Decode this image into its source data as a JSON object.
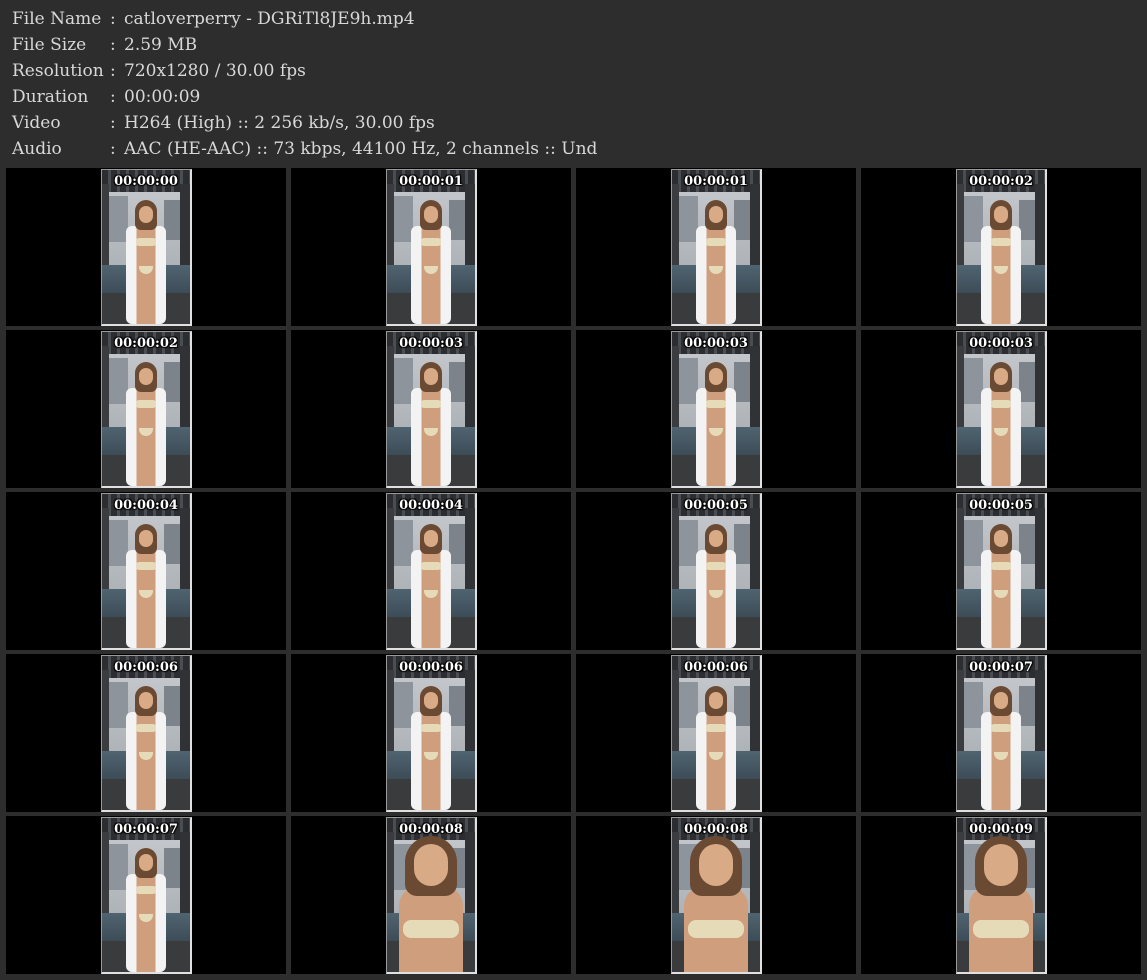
{
  "info": [
    {
      "label": "File Name",
      "sep": ":",
      "value": "catloverperry - DGRiTl8JE9h.mp4"
    },
    {
      "label": "File Size",
      "sep": ":",
      "value": "2.59 MB"
    },
    {
      "label": "Resolution",
      "sep": ":",
      "value": "720x1280 / 30.00 fps"
    },
    {
      "label": "Duration",
      "sep": ":",
      "value": "00:00:09"
    },
    {
      "label": "Video",
      "sep": ":",
      "value": "H264 (High) :: 2 256 kb/s, 30.00 fps"
    },
    {
      "label": "Audio",
      "sep": ":",
      "value": "AAC (HE-AAC) :: 73 kbps, 44100 Hz, 2 channels :: Und"
    }
  ],
  "thumbnails": [
    {
      "time": "00:00:00"
    },
    {
      "time": "00:00:01"
    },
    {
      "time": "00:00:01"
    },
    {
      "time": "00:00:02"
    },
    {
      "time": "00:00:02"
    },
    {
      "time": "00:00:03"
    },
    {
      "time": "00:00:03"
    },
    {
      "time": "00:00:03"
    },
    {
      "time": "00:00:04"
    },
    {
      "time": "00:00:04"
    },
    {
      "time": "00:00:05"
    },
    {
      "time": "00:00:05"
    },
    {
      "time": "00:00:06"
    },
    {
      "time": "00:00:06"
    },
    {
      "time": "00:00:06"
    },
    {
      "time": "00:00:07"
    },
    {
      "time": "00:00:07"
    },
    {
      "time": "00:00:08"
    },
    {
      "time": "00:00:08"
    },
    {
      "time": "00:00:09"
    }
  ],
  "colors": {
    "background": "#2d2d2d",
    "text": "#d8d8d8",
    "cell": "#000000",
    "timestamp": "#ffffff"
  }
}
